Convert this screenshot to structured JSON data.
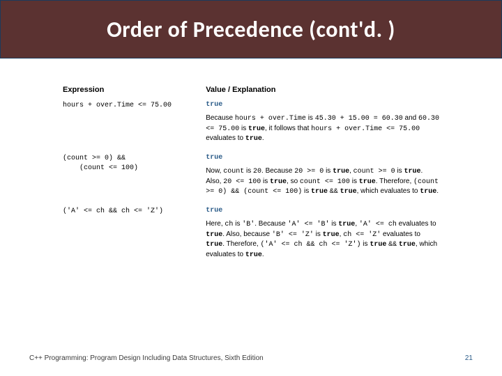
{
  "title": "Order of Precedence (cont'd. )",
  "headers": {
    "expression": "Expression",
    "value": "Value / Explanation"
  },
  "rows": [
    {
      "expr": "hours + over.Time <= 75.00",
      "value": "true",
      "explain": "Because <span class='mono'>hours + over.Time</span> is <span class='mono'>45.30 + 15.00 = 60.30</span> and <span class='mono'>60.30 <= 75.00</span> is <span class='kw'>true</span>, it follows that <span class='mono'>hours + over.Time <= 75.00</span> evaluates to <span class='kw'>true</span>."
    },
    {
      "expr": "(count >= 0) &&\n    (count <= 100)",
      "value": "true",
      "explain": "Now, <span class='mono'>count</span> is <span class='mono'>20</span>. Because <span class='mono'>20 &gt;= 0</span> is <span class='kw'>true</span>, <span class='mono'>count &gt;= 0</span> is <span class='kw'>true</span>. Also, <span class='mono'>20 &lt;= 100</span> is <span class='kw'>true</span>, so <span class='mono'>count &lt;= 100</span> is <span class='kw'>true</span>. Therefore, <span class='mono'>(count &gt;= 0) &amp;&amp; (count &lt;= 100)</span> is <span class='kw'>true</span> <span class='mono'>&amp;&amp;</span> <span class='kw'>true</span>, which evaluates to <span class='kw'>true</span>."
    },
    {
      "expr": "('A' <= ch && ch <= 'Z')",
      "value": "true",
      "explain": "Here, <span class='mono'>ch</span> is <span class='mono'>'B'</span>. Because <span class='mono'>'A' &lt;= 'B'</span> is <span class='kw'>true</span>, <span class='mono'>'A' &lt;= ch</span> evaluates to <span class='kw'>true</span>. Also, because <span class='mono'>'B' &lt;= 'Z'</span> is <span class='kw'>true</span>, <span class='mono'>ch &lt;= 'Z'</span> evaluates to <span class='kw'>true</span>. Therefore, <span class='mono'>('A' &lt;= ch &amp;&amp; ch &lt;= 'Z')</span> is <span class='kw'>true</span> <span class='mono'>&amp;&amp;</span> <span class='kw'>true</span>, which evaluates to <span class='kw'>true</span>."
    }
  ],
  "footer": {
    "book": "C++ Programming: Program Design Including Data Structures, Sixth Edition",
    "page": "21"
  }
}
